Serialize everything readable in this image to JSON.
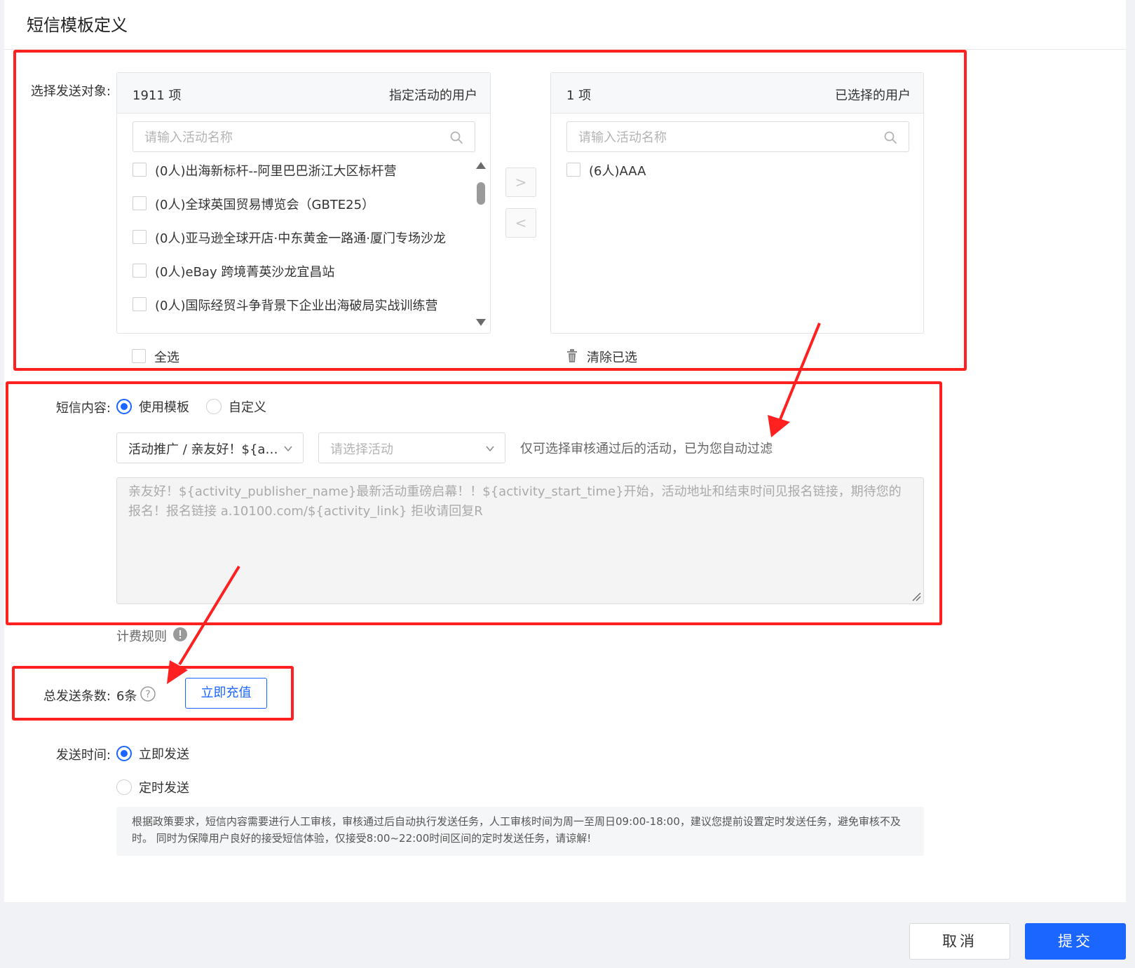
{
  "page": {
    "title": "短信模板定义"
  },
  "audience": {
    "label": "选择发送对象:",
    "source": {
      "count": "1911 项",
      "title": "指定活动的用户",
      "search_placeholder": "请输入活动名称",
      "items": [
        "(0人)出海新标杆--阿里巴巴浙江大区标杆营",
        "(0人)全球英国贸易博览会（GBTE25）",
        "(0人)亚马逊全球开店·中东黄金一路通·厦门专场沙龙",
        "(0人)eBay 跨境菁英沙龙宜昌站",
        "(0人)国际经贸斗争背景下企业出海破局实战训练营"
      ],
      "select_all": "全选"
    },
    "target": {
      "count": "1 项",
      "title": "已选择的用户",
      "search_placeholder": "请输入活动名称",
      "items": [
        "(6人)AAA"
      ],
      "clear": "清除已选"
    },
    "move_right": ">",
    "move_left": "<"
  },
  "content": {
    "label": "短信内容:",
    "option_template": "使用模板",
    "option_custom": "自定义",
    "selected": "使用模板",
    "template_select": "活动推广 / 亲友好！${activity_publisher_name}",
    "activity_placeholder": "请选择活动",
    "hint": "仅可选择审核通过后的活动，已为您自动过滤",
    "text": "亲友好！${activity_publisher_name}最新活动重磅启幕！！${activity_start_time}开始，活动地址和结束时间见报名链接，期待您的报名！报名链接 a.10100.com/${activity_link} 拒收请回复R",
    "billing_rule": "计费规则"
  },
  "total": {
    "label": "总发送条数:",
    "value": "6条",
    "recharge": "立即充值"
  },
  "schedule": {
    "label": "发送时间:",
    "option_now": "立即发送",
    "option_timed": "定时发送",
    "selected": "立即发送",
    "notice": "根据政策要求，短信内容需要进行人工审核，审核通过后自动执行发送任务，人工审核时间为周一至周日09:00-18:00，建议您提前设置定时发送任务，避免审核不及时。 同时为保障用户良好的接受短信体验，仅接受8:00~22:00时间区间的定时发送任务，请谅解!"
  },
  "footer": {
    "cancel": "取消",
    "submit": "提交"
  },
  "colors": {
    "primary": "#1a66ff",
    "annotation": "#ff2020"
  }
}
